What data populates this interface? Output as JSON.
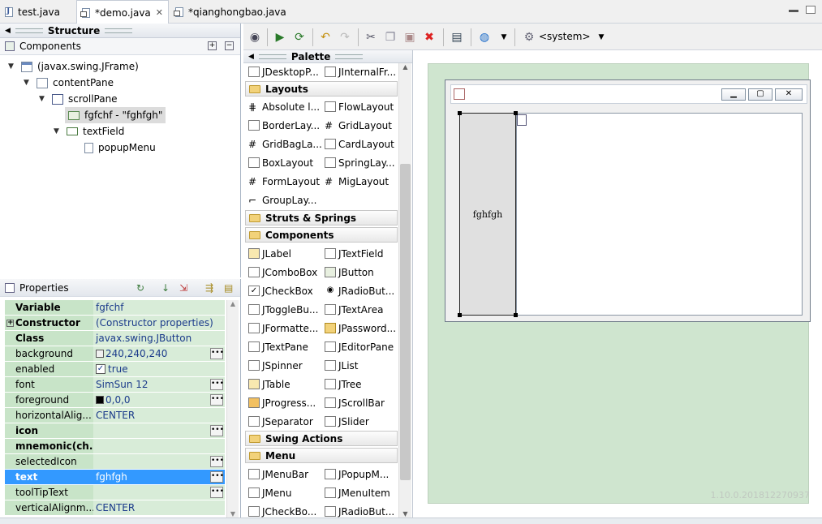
{
  "tabs": [
    {
      "label": "test.java"
    },
    {
      "label": "*demo.java"
    },
    {
      "label": "*qianghongbao.java"
    }
  ],
  "structure": {
    "title": "Structure",
    "components_label": "Components",
    "tree": [
      {
        "label": "(javax.swing.JFrame)"
      },
      {
        "label": "contentPane"
      },
      {
        "label": "scrollPane"
      },
      {
        "label": "fgfchf - \"fghfgh\""
      },
      {
        "label": "textField"
      },
      {
        "label": "popupMenu"
      }
    ]
  },
  "properties": {
    "title": "Properties",
    "rows": [
      {
        "name": "Variable",
        "value": "fgfchf"
      },
      {
        "name": "Constructor",
        "value": "(Constructor properties)"
      },
      {
        "name": "Class",
        "value": "javax.swing.JButton"
      },
      {
        "name": "background",
        "value": "240,240,240"
      },
      {
        "name": "enabled",
        "value": "true"
      },
      {
        "name": "font",
        "value": "SimSun 12"
      },
      {
        "name": "foreground",
        "value": "0,0,0"
      },
      {
        "name": "horizontalAlig...",
        "value": "CENTER"
      },
      {
        "name": "icon",
        "value": ""
      },
      {
        "name": "mnemonic(ch...",
        "value": ""
      },
      {
        "name": "selectedIcon",
        "value": ""
      },
      {
        "name": "text",
        "value": "fghfgh"
      },
      {
        "name": "toolTipText",
        "value": ""
      },
      {
        "name": "verticalAlignm...",
        "value": "CENTER"
      }
    ]
  },
  "toolbar": {
    "lookandfeel": "<system>"
  },
  "palette": {
    "title": "Palette",
    "top_items": [
      "JDesktopP...",
      "JInternalFr..."
    ],
    "layouts": {
      "label": "Layouts",
      "items": [
        "Absolute l...",
        "FlowLayout",
        "BorderLay...",
        "GridLayout",
        "GridBagLa...",
        "CardLayout",
        "BoxLayout",
        "SpringLay...",
        "FormLayout",
        "MigLayout",
        "GroupLay..."
      ]
    },
    "struts": {
      "label": "Struts & Springs"
    },
    "components": {
      "label": "Components",
      "items": [
        "JLabel",
        "JTextField",
        "JComboBox",
        "JButton",
        "JCheckBox",
        "JRadioBut...",
        "JToggleBu...",
        "JTextArea",
        "JFormatte...",
        "JPassword...",
        "JTextPane",
        "JEditorPane",
        "JSpinner",
        "JList",
        "JTable",
        "JTree",
        "JProgress...",
        "JScrollBar",
        "JSeparator",
        "JSlider"
      ]
    },
    "swing_actions": {
      "label": "Swing Actions"
    },
    "menu": {
      "label": "Menu",
      "items": [
        "JMenuBar",
        "JPopupM...",
        "JMenu",
        "JMenuItem",
        "JCheckBo...",
        "JRadioBut..."
      ]
    }
  },
  "design": {
    "button_text": "fghfgh",
    "version": "1.10.0.201812270937"
  }
}
